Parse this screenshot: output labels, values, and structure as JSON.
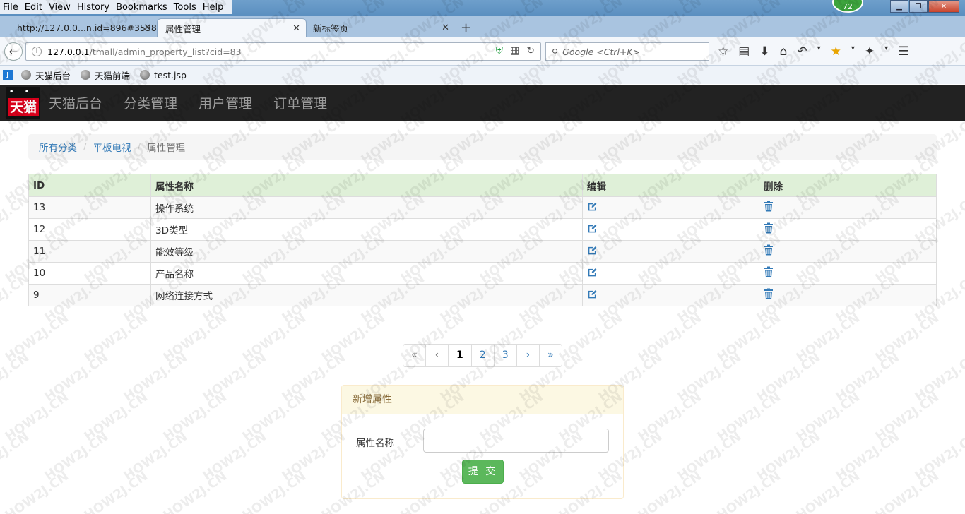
{
  "browser": {
    "menu": [
      "File",
      "Edit",
      "View",
      "History",
      "Bookmarks",
      "Tools",
      "Help"
    ],
    "badge": "72",
    "tabs": [
      {
        "label": "http://127.0.0...n.id=896#3538",
        "active": false
      },
      {
        "label": "属性管理",
        "active": true
      },
      {
        "label": "新标签页",
        "active": false
      }
    ],
    "url_host": "127.0.0.1",
    "url_path": "/tmall/admin_property_list?cid=83",
    "search_placeholder": "Google <Ctrl+K>",
    "bookmarks": [
      "天猫后台",
      "天猫前端",
      "test.jsp"
    ]
  },
  "app": {
    "logo_text": "天猫",
    "nav": [
      "天猫后台",
      "分类管理",
      "用户管理",
      "订单管理"
    ]
  },
  "breadcrumb": {
    "items": [
      "所有分类",
      "平板电视"
    ],
    "current": "属性管理"
  },
  "table": {
    "headers": [
      "ID",
      "属性名称",
      "编辑",
      "删除"
    ],
    "rows": [
      {
        "id": "13",
        "name": "操作系统"
      },
      {
        "id": "12",
        "name": "3D类型"
      },
      {
        "id": "11",
        "name": "能效等级"
      },
      {
        "id": "10",
        "name": "产品名称"
      },
      {
        "id": "9",
        "name": "网络连接方式"
      }
    ]
  },
  "pagination": [
    "«",
    "‹",
    "1",
    "2",
    "3",
    "›",
    "»"
  ],
  "form": {
    "title": "新增属性",
    "field_label": "属性名称",
    "field_value": "",
    "submit_label": "提 交"
  },
  "colors": {
    "navbar": "#222222",
    "table_header": "#dff0d8",
    "submit": "#5cb85c",
    "link": "#337ab7",
    "panel_heading": "#fcf8e3"
  },
  "watermark": "HOW2J.CN"
}
